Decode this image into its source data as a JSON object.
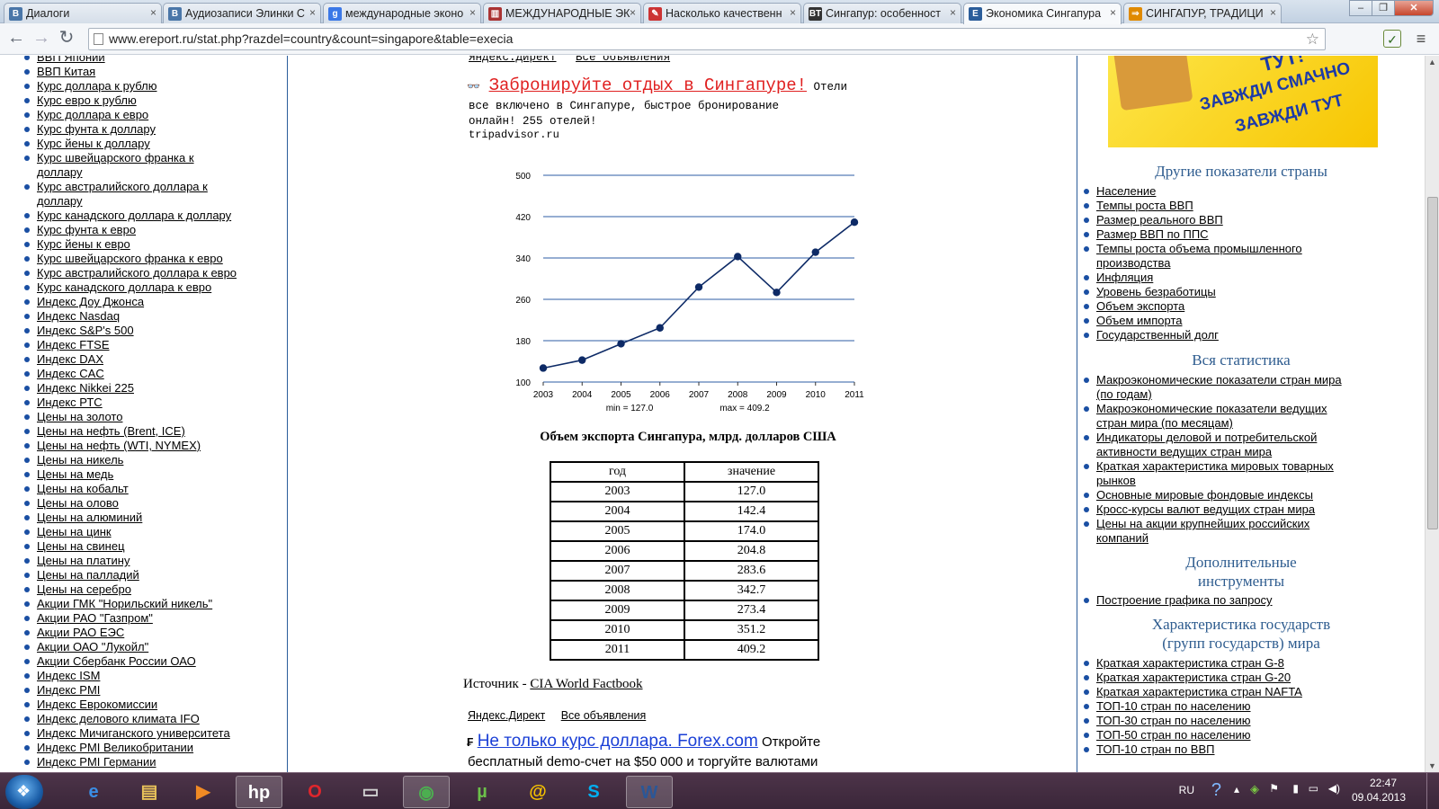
{
  "tabs": [
    {
      "label": "Диалоги",
      "icon": "vk-icon",
      "color": "#4a76a8",
      "glyph": "B"
    },
    {
      "label": "Аудиозаписи Элинки С",
      "icon": "vk-icon",
      "color": "#4a76a8",
      "glyph": "B"
    },
    {
      "label": "международные эконо",
      "icon": "google-icon",
      "color": "#3b78e7",
      "glyph": "g"
    },
    {
      "label": "МЕЖДУНАРОДНЫЕ ЭК",
      "icon": "book-icon",
      "color": "#a33",
      "glyph": "▥"
    },
    {
      "label": "Насколько качественн",
      "icon": "article-icon",
      "color": "#c33",
      "glyph": "✎"
    },
    {
      "label": "Сингапур: особенност",
      "icon": "bt-icon",
      "color": "#333",
      "glyph": "BT"
    },
    {
      "label": "Экономика Сингапура",
      "icon": "ereport-icon",
      "color": "#2b5d9a",
      "glyph": "E"
    },
    {
      "label": "СИНГАПУР, ТРАДИЦИ",
      "icon": "arrow-icon",
      "color": "#e08a00",
      "glyph": "⇒"
    }
  ],
  "url": "www.ereport.ru/stat.php?razdel=country&count=singapore&table=execia",
  "left_links": [
    "ВВП Японии",
    "ВВП Китая",
    "Курс доллара к рублю",
    "Курс евро к рублю",
    "Курс доллара к евро",
    "Курс фунта к доллару",
    "Курс йены к доллару",
    "Курс швейцарского франка к",
    "доллару",
    "Курс австралийского доллара к",
    "доллару",
    "Курс канадского доллара к доллару",
    "Курс фунта к евро",
    "Курс йены к евро",
    "Курс швейцарского франка к евро",
    "Курс австралийского доллара к евро",
    "Курс канадского доллара к евро",
    "Индекс Доу Джонса",
    "Индекс Nasdaq",
    "Индекс S&P's 500",
    "Индекс FTSE",
    "Индекс DAX",
    "Индекс CAC",
    "Индекс Nikkei 225",
    "Индекс РТС",
    "Цены на золото",
    "Цены на нефть (Brent, ICE)",
    "Цены на нефть (WTI, NYMEX)",
    "Цены на никель",
    "Цены на медь",
    "Цены на кобальт",
    "Цены на олово",
    "Цены на алюминий",
    "Цены на цинк",
    "Цены на свинец",
    "Цены на платину",
    "Цены на палладий",
    "Цены на серебро",
    "Акции ГМК \"Норильский никель\"",
    "Акции РАО \"Газпром\"",
    "Акции РАО ЕЭС",
    "Акции ОАО \"Лукойл\"",
    "Акции Сбербанк России ОАО",
    "Индекс ISM",
    "Индекс PMI",
    "Индекс Еврокомиссии",
    "Индекс делового климата IFO",
    "Индекс Мичиганского университета",
    "Индекс PMI Великобритании",
    "Индекс PMI Германии"
  ],
  "ad1": {
    "links": [
      "Яндекс.Директ",
      "Все объявления"
    ],
    "title": "Забронируйте отдых в Сингапуре!",
    "body1": " Отели",
    "body2": "все включено в Сингапуре, быстрое бронирование",
    "body3": "онлайн! 255 отелей!",
    "domain": "tripadvisor.ru"
  },
  "chart_data": {
    "type": "line",
    "categories": [
      "2003",
      "2004",
      "2005",
      "2006",
      "2007",
      "2008",
      "2009",
      "2010",
      "2011"
    ],
    "values": [
      127.0,
      142.4,
      174.0,
      204.8,
      283.6,
      342.7,
      273.4,
      351.2,
      409.2
    ],
    "y_ticks": [
      "100",
      "180",
      "260",
      "340",
      "420",
      "500"
    ],
    "ylim": [
      100,
      500
    ],
    "grid": true,
    "min_label": "min = 127.0",
    "max_label": "max = 409.2",
    "title": "Объем экспорта Сингапура, млрд. долларов США",
    "line_color": "#0d2a66",
    "grid_color": "#2c5ea6"
  },
  "table": {
    "headers": [
      "год",
      "значение"
    ],
    "rows": [
      [
        "2003",
        "127.0"
      ],
      [
        "2004",
        "142.4"
      ],
      [
        "2005",
        "174.0"
      ],
      [
        "2006",
        "204.8"
      ],
      [
        "2007",
        "283.6"
      ],
      [
        "2008",
        "342.7"
      ],
      [
        "2009",
        "273.4"
      ],
      [
        "2010",
        "351.2"
      ],
      [
        "2011",
        "409.2"
      ]
    ]
  },
  "source": {
    "label": "Источник - ",
    "link": "CIA World Factbook"
  },
  "ad2": {
    "links": [
      "Яндекс.Директ",
      "Все объявления"
    ],
    "title": "Не только курс доллара. Forex.com",
    "body1": " Откройте",
    "body2": "бесплатный demo-счет на $50 000 и торгуйте валютами"
  },
  "banner": {
    "lines": [
      "ТУТ!",
      "ЗАВЖДИ СМАЧНО",
      "ЗАВЖДИ ТУТ"
    ]
  },
  "right": {
    "sections": [
      {
        "title": "Другие показатели страны",
        "items": [
          "Население",
          "Темпы роста ВВП",
          "Размер реального ВВП",
          "Размер ВВП по ППС",
          "Темпы роста объема промышленного",
          "производства",
          "Инфляция",
          "Уровень безработицы",
          "Объем экспорта",
          "Объем импорта",
          "Государственный долг"
        ]
      },
      {
        "title": "Вся статистика",
        "items": [
          "Макроэкономические показатели стран мира",
          "(по годам)",
          "Макроэкономические показатели ведущих",
          "стран мира (по месяцам)",
          "Индикаторы деловой и потребительской",
          "активности ведущих стран мира",
          "Краткая характеристика мировых товарных",
          "рынков",
          "Основные мировые фондовые индексы",
          "Кросс-курсы валют ведущих стран мира",
          "Цены на акции крупнейших российских",
          "компаний"
        ]
      },
      {
        "title": "Дополнительные",
        "title2": "инструменты",
        "items": [
          "Построение графика по запросу"
        ]
      },
      {
        "title": "Характеристика государств",
        "title2": "(групп государств) мира",
        "items": [
          "Краткая характеристика стран G-8",
          "Краткая характеристика стран G-20",
          "Краткая характеристика стран NAFTA",
          "ТОП-10 стран по населению",
          "ТОП-30 стран по населению",
          "ТОП-50 стран по населению",
          "ТОП-10 стран по ВВП"
        ]
      }
    ]
  },
  "taskbar": {
    "apps": [
      {
        "name": "ie-icon",
        "glyph": "e",
        "color": "#3a8ee6"
      },
      {
        "name": "explorer-icon",
        "glyph": "▤",
        "color": "#e8c25a"
      },
      {
        "name": "media-player-icon",
        "glyph": "▶",
        "color": "#f08a24"
      },
      {
        "name": "hp-icon",
        "glyph": "hp",
        "color": "#ffffff"
      },
      {
        "name": "opera-icon",
        "glyph": "O",
        "color": "#e0262c"
      },
      {
        "name": "printer-icon",
        "glyph": "▭",
        "color": "#d0d0d0"
      },
      {
        "name": "chrome-icon",
        "glyph": "◉",
        "color": "#4caf50"
      },
      {
        "name": "utorrent-icon",
        "glyph": "µ",
        "color": "#6cc04a"
      },
      {
        "name": "mail-agent-icon",
        "glyph": "@",
        "color": "#f6c200"
      },
      {
        "name": "skype-icon",
        "glyph": "S",
        "color": "#00aff0"
      },
      {
        "name": "word-icon",
        "glyph": "W",
        "color": "#2b5797"
      }
    ],
    "lang": "RU",
    "time": "22:47",
    "date": "09.04.2013"
  }
}
